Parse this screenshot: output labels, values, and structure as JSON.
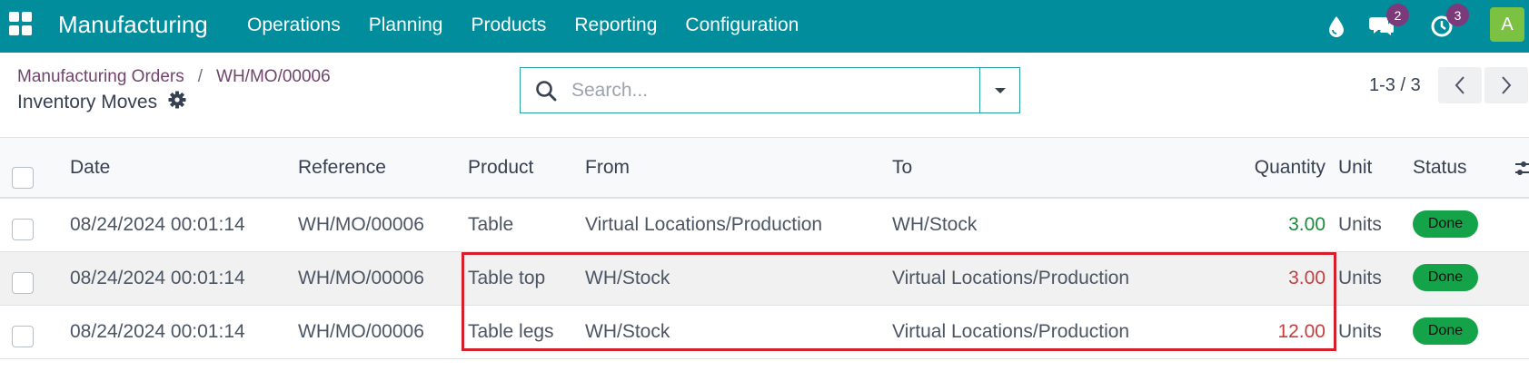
{
  "navbar": {
    "brand": "Manufacturing",
    "menu": [
      "Operations",
      "Planning",
      "Products",
      "Reporting",
      "Configuration"
    ],
    "icons": [
      "apps-grid-icon",
      "water-drop-icon",
      "chat-icon",
      "clock-icon"
    ],
    "messages_count": "2",
    "activities_count": "3",
    "avatar_initial": "A",
    "colors": {
      "bar": "#018d9c",
      "badge": "#7b3a7a",
      "avatar": "#7cc242"
    }
  },
  "breadcrumb": {
    "parent": "Manufacturing Orders",
    "separator": "/",
    "current_record": "WH/MO/00006"
  },
  "page": {
    "title": "Inventory Moves"
  },
  "search": {
    "placeholder": "Search...",
    "value": ""
  },
  "pager": {
    "value": "1-3 / 3"
  },
  "table": {
    "headers": {
      "date": "Date",
      "reference": "Reference",
      "product": "Product",
      "from": "From",
      "to": "To",
      "quantity": "Quantity",
      "unit": "Unit",
      "status": "Status"
    },
    "rows": [
      {
        "date": "08/24/2024 00:01:14",
        "reference": "WH/MO/00006",
        "product": "Table",
        "from": "Virtual Locations/Production",
        "to": "WH/Stock",
        "quantity": "3.00",
        "unit": "Units",
        "status": "Done"
      },
      {
        "date": "08/24/2024 00:01:14",
        "reference": "WH/MO/00006",
        "product": "Table top",
        "from": "WH/Stock",
        "to": "Virtual Locations/Production",
        "quantity": "3.00",
        "unit": "Units",
        "status": "Done"
      },
      {
        "date": "08/24/2024 00:01:14",
        "reference": "WH/MO/00006",
        "product": "Table legs",
        "from": "WH/Stock",
        "to": "Virtual Locations/Production",
        "quantity": "12.00",
        "unit": "Units",
        "status": "Done"
      }
    ],
    "colors": {
      "incoming_qty": "#1b8a3d",
      "outgoing_qty": "#c73e3e",
      "status_done": "#15a34a",
      "highlight_border": "#d3202a"
    }
  }
}
